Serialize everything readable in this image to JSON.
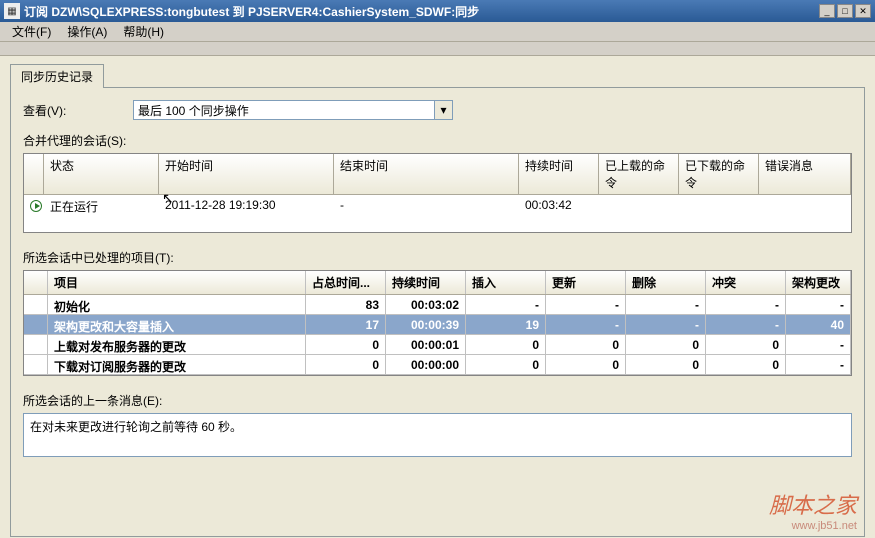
{
  "window": {
    "title": "订阅 DZW\\SQLEXPRESS:tongbutest 到 PJSERVER4:CashierSystem_SDWF:同步"
  },
  "menu": {
    "file": "文件(F)",
    "action": "操作(A)",
    "help": "帮助(H)"
  },
  "tabs": {
    "history": "同步历史记录"
  },
  "view": {
    "label": "查看(V):",
    "selected": "最后 100 个同步操作"
  },
  "sessions": {
    "label": "合并代理的会话(S):",
    "cols": {
      "c0": "",
      "c1": "状态",
      "c2": "开始时间",
      "c3": "结束时间",
      "c4": "持续时间",
      "c5": "已上载的命令",
      "c6": "已下载的命令",
      "c7": "错误消息"
    },
    "rows": [
      {
        "status": "正在运行",
        "start": "2011-12-28 19:19:30",
        "end": "-",
        "dur": "00:03:42",
        "up": "",
        "down": "",
        "err": ""
      }
    ]
  },
  "items": {
    "label": "所选会话中已处理的项目(T):",
    "cols": {
      "c1": "项目",
      "c2": "占总时间...",
      "c3": "持续时间",
      "c4": "插入",
      "c5": "更新",
      "c6": "删除",
      "c7": "冲突",
      "c8": "架构更改"
    },
    "rows": [
      {
        "name": "初始化",
        "pct": "83",
        "dur": "00:03:02",
        "ins": "-",
        "upd": "-",
        "del": "-",
        "con": "-",
        "sch": "-"
      },
      {
        "name": "架构更改和大容量插入",
        "pct": "17",
        "dur": "00:00:39",
        "ins": "19",
        "upd": "-",
        "del": "-",
        "con": "-",
        "sch": "40"
      },
      {
        "name": "上载对发布服务器的更改",
        "pct": "0",
        "dur": "00:00:01",
        "ins": "0",
        "upd": "0",
        "del": "0",
        "con": "0",
        "sch": "-"
      },
      {
        "name": "下载对订阅服务器的更改",
        "pct": "0",
        "dur": "00:00:00",
        "ins": "0",
        "upd": "0",
        "del": "0",
        "con": "0",
        "sch": "-"
      }
    ]
  },
  "message": {
    "label": "所选会话的上一条消息(E):",
    "text": "在对未来更改进行轮询之前等待 60 秒。"
  },
  "watermark": {
    "line1": "脚本之家",
    "line2": "www.jb51.net"
  }
}
